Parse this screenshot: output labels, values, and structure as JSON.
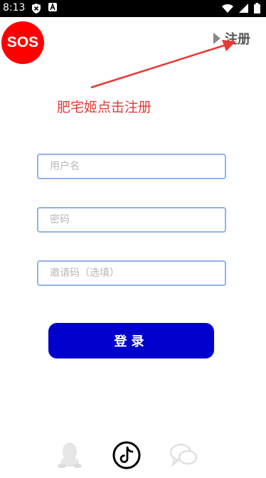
{
  "status_bar": {
    "time": "8:13",
    "icon_a": "shield-icon",
    "icon_b": "A",
    "right_icons": [
      "wifi-icon",
      "signal-icon",
      "battery-icon"
    ]
  },
  "sos_label": "SOS",
  "register_link": "注册",
  "annotation": "肥宅姬点击注册",
  "fields": {
    "username_placeholder": "用户名",
    "password_placeholder": "密码",
    "invite_placeholder": "邀请码（选填）"
  },
  "login_label": "登录",
  "social_icons": [
    "qq-icon",
    "tiktok-icon",
    "chat-icon"
  ],
  "colors": {
    "sos": "#ff0000",
    "annotation": "#e53935",
    "field_border": "#8fb2ec",
    "login_button": "#0000cc"
  }
}
